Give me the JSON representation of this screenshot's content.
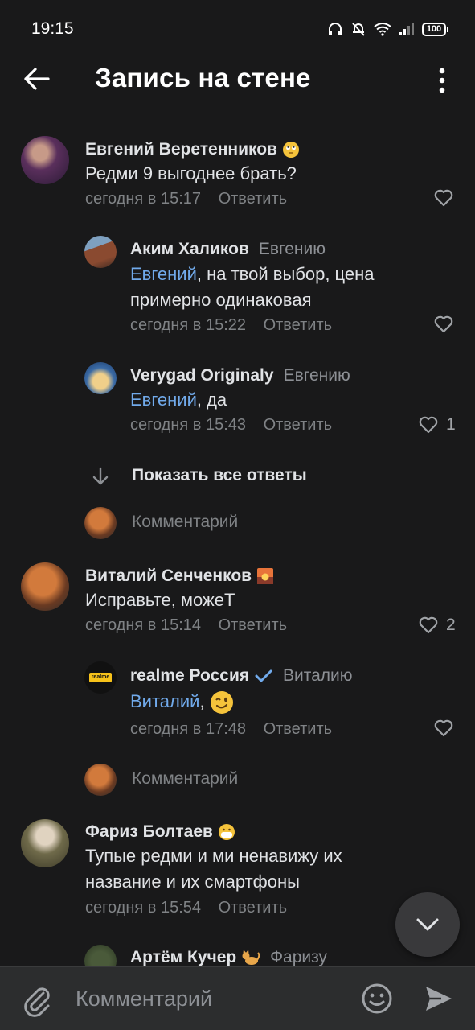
{
  "status_bar": {
    "time": "19:15",
    "battery": "100"
  },
  "header": {
    "title": "Запись на стене"
  },
  "comments": [
    {
      "author": "Евгений Веретенников",
      "text": "Редми 9 выгоднее брать?",
      "time": "сегодня в 15:17",
      "reply_label": "Ответить",
      "likes": "",
      "replies": [
        {
          "author": "Аким Халиков",
          "reply_to": "Евгению",
          "mention": "Евгений",
          "text": ", на твой выбор, цена",
          "text2": "примерно одинаковая",
          "time": "сегодня в 15:22",
          "reply_label": "Ответить",
          "likes": ""
        },
        {
          "author": "Verygad Originaly",
          "reply_to": "Евгению",
          "mention": "Евгений",
          "text": ", да",
          "time": "сегодня в 15:43",
          "reply_label": "Ответить",
          "likes": "1"
        }
      ]
    },
    {
      "author": "Виталий Сенченков",
      "text": "Исправьте, можеТ",
      "time": "сегодня в 15:14",
      "reply_label": "Ответить",
      "likes": "2",
      "replies": [
        {
          "author": "realme Россия",
          "reply_to": "Виталию",
          "mention": "Виталий",
          "text": ",",
          "time": "сегодня в 17:48",
          "reply_label": "Ответить",
          "likes": "",
          "avatar_text": "realme"
        }
      ]
    },
    {
      "author": "Фариз Болтаев",
      "text": "Тупые редми и ми ненавижу их",
      "text2": "название и их смартфоны",
      "time": "сегодня в 15:54",
      "reply_label": "Ответить",
      "likes": "",
      "replies": [
        {
          "author": "Артём Кучер",
          "reply_to": "Фаризу"
        }
      ]
    }
  ],
  "show_all_replies": "Показать все ответы",
  "write_comment": "Комментарий",
  "bottom_bar": {
    "placeholder": "Комментарий"
  },
  "colors": {
    "background": "#19191a",
    "mention": "#71aaeb",
    "muted": "#7f8285",
    "bar": "#2c2d2e",
    "verified": "#71aaeb"
  }
}
